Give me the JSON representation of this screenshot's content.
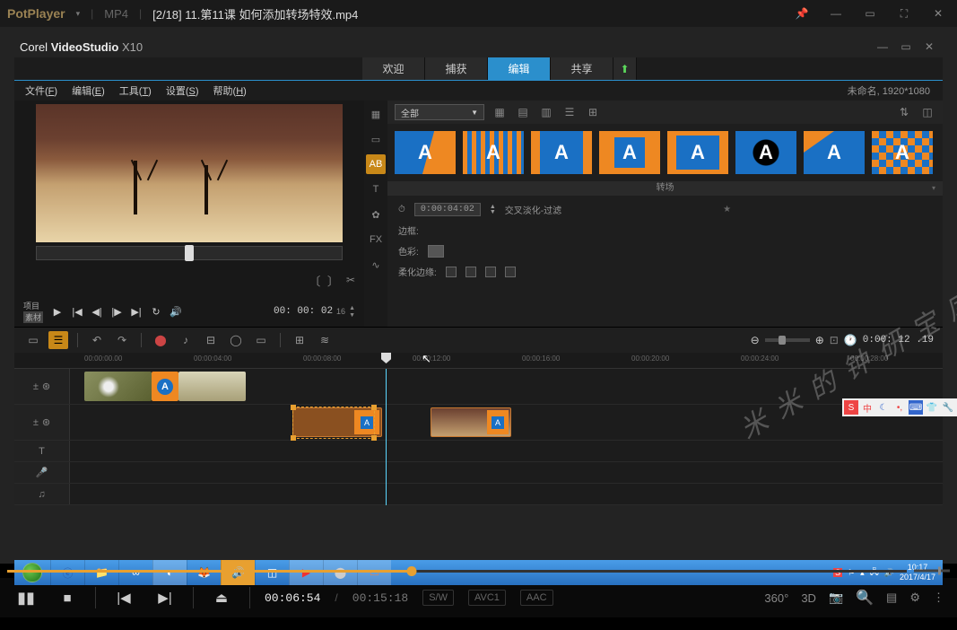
{
  "potplayer": {
    "name": "PotPlayer",
    "format": "MP4",
    "filename": "[2/18] 11.第11课 如何添加转场特效.mp4",
    "time_current": "00:06:54",
    "time_duration": "00:15:18",
    "badges": {
      "sw": "S/W",
      "vcodec": "AVC1",
      "acodec": "AAC"
    },
    "right_icons": {
      "vr": "360°",
      "threed": "3D"
    }
  },
  "videostudio": {
    "brand_a": "Corel",
    "brand_b": "VideoStudio",
    "brand_c": "X10",
    "tabs": {
      "welcome": "欢迎",
      "capture": "捕获",
      "edit": "编辑",
      "share": "共享"
    },
    "menu": {
      "file": "文件",
      "file_u": "F",
      "edit": "编辑",
      "edit_u": "E",
      "tools": "工具",
      "tools_u": "T",
      "settings": "设置",
      "settings_u": "S",
      "help": "帮助",
      "help_u": "H"
    },
    "project_info": "未命名, 1920*1080",
    "preview": {
      "mode_a": "项目",
      "mode_b": "素材",
      "timecode": "00: 00: 02",
      "frames": "16"
    },
    "library": {
      "side": {
        "ab": "AB",
        "t": "T",
        "fx": "FX"
      },
      "category": "全部",
      "section": "转场",
      "duration_icon": "⏱",
      "duration": "0:00:04:02",
      "effect_name": "交叉淡化-过滤",
      "row_border": "边框:",
      "row_color": "色彩:",
      "row_soft": "柔化边缘:",
      "star": "★"
    },
    "timeline": {
      "zoom_time": "0:00: 12 .19",
      "ticks": [
        "00:00:00.00",
        "00:00:04:00",
        "00:00:08:00",
        "00:00:12:00",
        "00:00:16:00",
        "00:00:20:00",
        "00:00:24:00",
        "00:00:28:00"
      ]
    }
  },
  "taskbar": {
    "time": "10:17",
    "date": "2017/4/17"
  },
  "watermark": "米米的钟研宝库"
}
